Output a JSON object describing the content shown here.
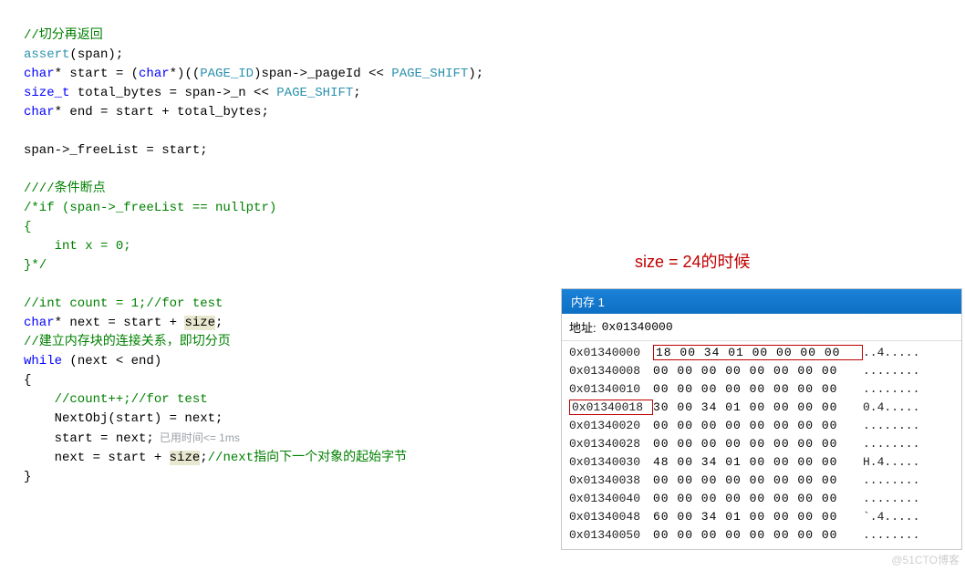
{
  "code": {
    "c1": "//切分再返回",
    "c2a": "assert",
    "c2b": "(span);",
    "c3a": "char",
    "c3b": "* start = (",
    "c3c": "char",
    "c3d": "*)((",
    "c3e": "PAGE_ID",
    "c3f": ")span->_pageId << ",
    "c3g": "PAGE_SHIFT",
    "c3h": ");",
    "c4a": "size_t",
    "c4b": " total_bytes = span->_n << ",
    "c4c": "PAGE_SHIFT",
    "c4d": ";",
    "c5a": "char",
    "c5b": "* end = start + total_bytes;",
    "blank1": " ",
    "c7": "span->_freeList = start;",
    "blank2": " ",
    "c9": "////条件断点",
    "c10": "/*if (span->_freeList == nullptr)",
    "c11": "{",
    "c12": "    int x = 0;",
    "c13": "}*/",
    "blank3": " ",
    "c15": "//int count = 1;//for test",
    "c16a": "char",
    "c16b": "* next = start + ",
    "c16c": "size",
    "c16d": ";",
    "c17": "//建立内存块的连接关系，即切分页",
    "c18a": "while",
    "c18b": " (next < end)",
    "c19": "{",
    "c20": "    //count++;//for test",
    "c21": "    NextObj(start) = next;",
    "c22": "    start = next;",
    "c22hint": "已用时间<= 1ms",
    "c23a": "    next = start + ",
    "c23b": "size",
    "c23c": ";",
    "c23d": "//next指向下一个对象的起始字节",
    "c24": "}"
  },
  "annotation": "size =  24的时候",
  "memory": {
    "title": "内存 1",
    "addr_label": "地址:",
    "addr_value": "0x01340000",
    "rows": [
      {
        "addr": "0x01340000",
        "hex": "18 00 34 01 00 00 00 00",
        "ascii": "..4.....",
        "addrBoxed": false,
        "hexBoxed": true
      },
      {
        "addr": "0x01340008",
        "hex": "00 00 00 00 00 00 00 00",
        "ascii": "........",
        "addrBoxed": false,
        "hexBoxed": false
      },
      {
        "addr": "0x01340010",
        "hex": "00 00 00 00 00 00 00 00",
        "ascii": "........",
        "addrBoxed": false,
        "hexBoxed": false
      },
      {
        "addr": "0x01340018",
        "hex": "30 00 34 01 00 00 00 00",
        "ascii": "0.4.....",
        "addrBoxed": true,
        "hexBoxed": false
      },
      {
        "addr": "0x01340020",
        "hex": "00 00 00 00 00 00 00 00",
        "ascii": "........",
        "addrBoxed": false,
        "hexBoxed": false
      },
      {
        "addr": "0x01340028",
        "hex": "00 00 00 00 00 00 00 00",
        "ascii": "........",
        "addrBoxed": false,
        "hexBoxed": false
      },
      {
        "addr": "0x01340030",
        "hex": "48 00 34 01 00 00 00 00",
        "ascii": "H.4.....",
        "addrBoxed": false,
        "hexBoxed": false
      },
      {
        "addr": "0x01340038",
        "hex": "00 00 00 00 00 00 00 00",
        "ascii": "........",
        "addrBoxed": false,
        "hexBoxed": false
      },
      {
        "addr": "0x01340040",
        "hex": "00 00 00 00 00 00 00 00",
        "ascii": "........",
        "addrBoxed": false,
        "hexBoxed": false
      },
      {
        "addr": "0x01340048",
        "hex": "60 00 34 01 00 00 00 00",
        "ascii": "`.4.....",
        "addrBoxed": false,
        "hexBoxed": false
      },
      {
        "addr": "0x01340050",
        "hex": "00 00 00 00 00 00 00 00",
        "ascii": "........",
        "addrBoxed": false,
        "hexBoxed": false
      }
    ]
  },
  "watermark": "@51CTO博客"
}
